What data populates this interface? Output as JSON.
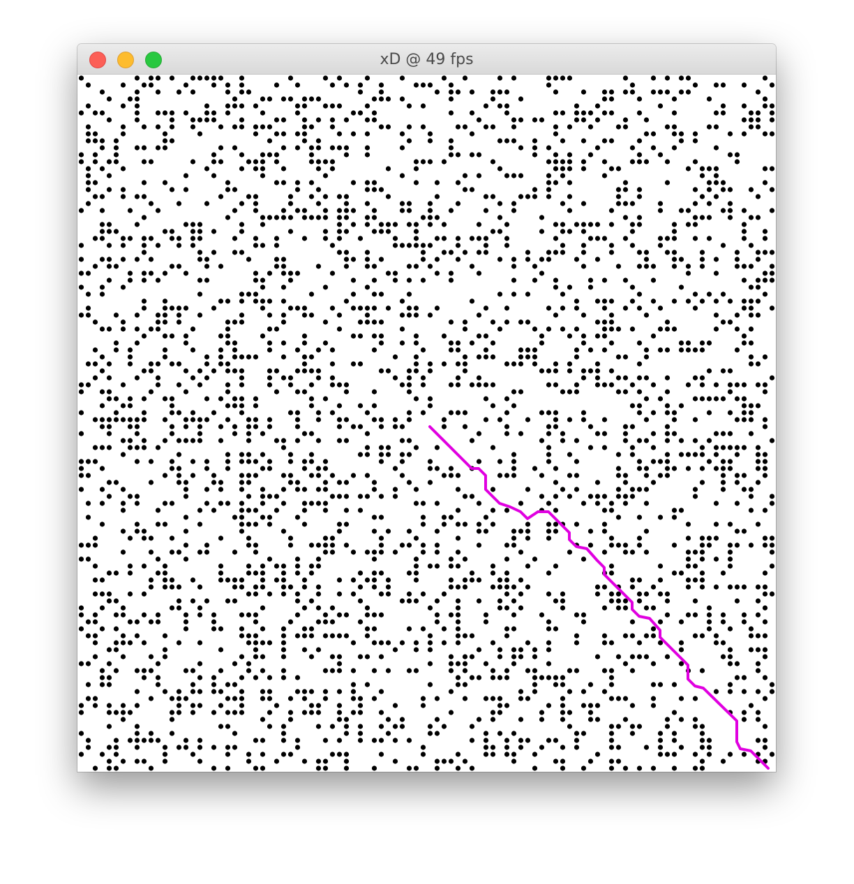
{
  "window": {
    "title": "xD @ 49 fps",
    "controls": {
      "close_icon": "close-icon",
      "minimize_icon": "minimize-icon",
      "zoom_icon": "zoom-icon"
    }
  },
  "canvas": {
    "dot_color": "#000000",
    "path_color": "#e000e0",
    "background": "#ffffff",
    "grid_cells": 100,
    "obstacle_density": 0.28
  },
  "colors": {
    "close": "#fc5f57",
    "minimize": "#fdbc2e",
    "zoom": "#29c840"
  }
}
